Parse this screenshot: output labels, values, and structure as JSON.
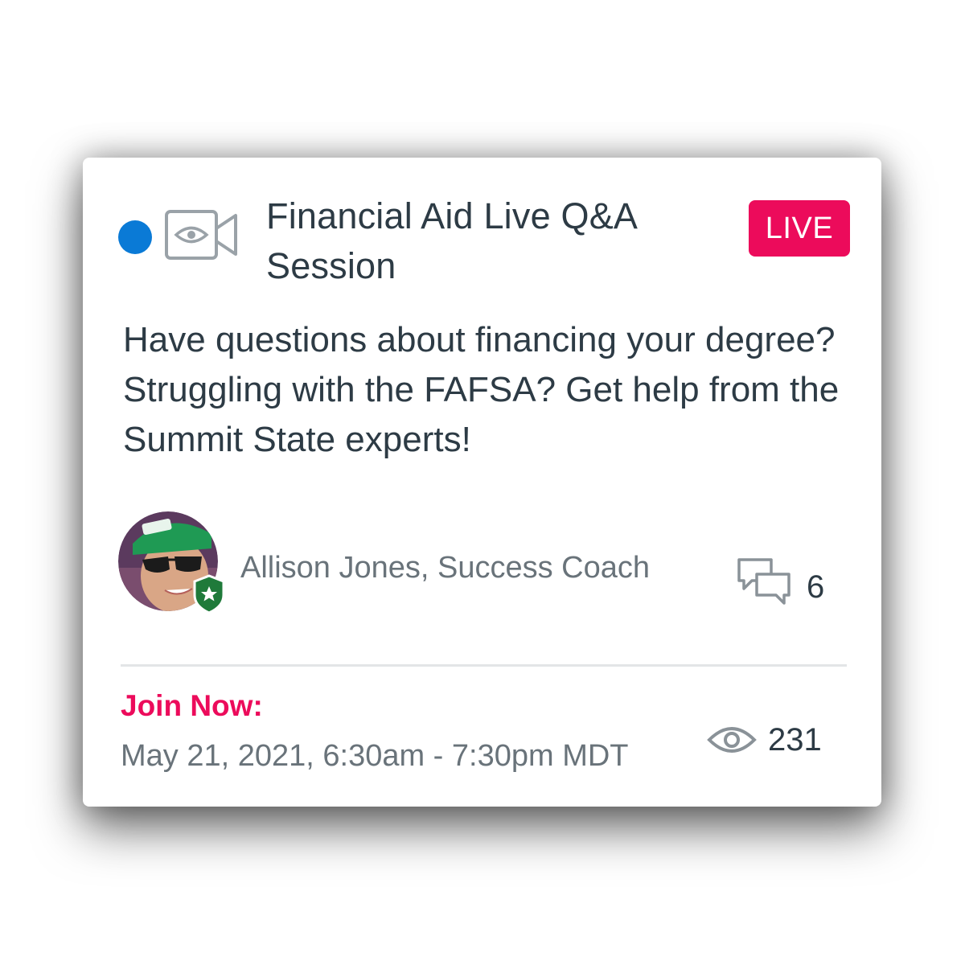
{
  "event": {
    "title": "Financial Aid Live Q&A Session",
    "status_badge": "LIVE",
    "description": "Have questions about financing your degree? Struggling with the FAFSA? Get help from the Summit State experts!",
    "unread_indicator_color": "#0a7ad6",
    "type_icon": "video-eye-icon"
  },
  "author": {
    "name": "Allison Jones, Success Coach",
    "badge_icon": "star-shield-icon"
  },
  "stats": {
    "comments_icon": "comments-icon",
    "comments_count": "6",
    "views_icon": "eye-icon",
    "views_count": "231"
  },
  "footer": {
    "join_label": "Join Now:",
    "date_range": "May 21, 2021, 6:30am - 7:30pm MDT"
  },
  "colors": {
    "accent": "#ec0b5b",
    "text_primary": "#2d3b45",
    "text_secondary": "#69737a",
    "badge_green": "#1f7a3a"
  }
}
